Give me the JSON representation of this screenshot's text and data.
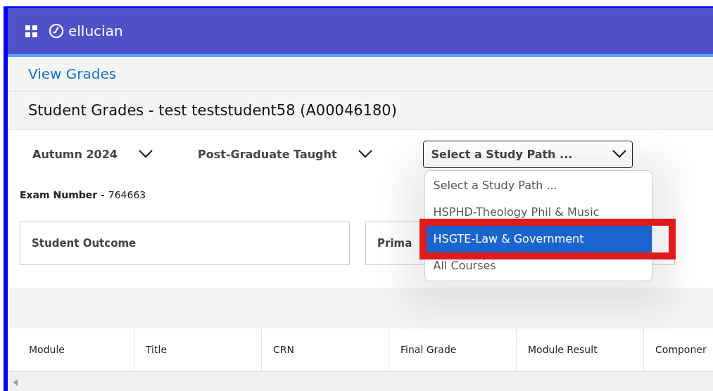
{
  "header": {
    "brand": "ellucian"
  },
  "breadcrumb": {
    "link": "View Grades"
  },
  "page_title": "Student Grades - test teststudent58 (A00046180)",
  "filters": [
    {
      "kind": "plain",
      "value": "Autumn 2024"
    },
    {
      "kind": "plain",
      "value": "Post-Graduate Taught"
    },
    {
      "kind": "boxed",
      "value": "Select a Study Path ...",
      "expanded": true,
      "options": [
        {
          "label": "Select a Study Path ...",
          "highlighted": false
        },
        {
          "label": "HSPHD-Theology Phil & Music",
          "highlighted": false
        },
        {
          "label": "HSGTE-Law & Government",
          "highlighted": true
        },
        {
          "label": "All Courses",
          "highlighted": false
        }
      ]
    }
  ],
  "exam_number": {
    "label": "Exam Number - ",
    "value": "764663"
  },
  "cards": [
    {
      "title": "Student Outcome"
    },
    {
      "title": "Prima"
    }
  ],
  "table": {
    "columns": [
      "Module",
      "Title",
      "CRN",
      "Final Grade",
      "Module Result",
      "Componer"
    ]
  }
}
